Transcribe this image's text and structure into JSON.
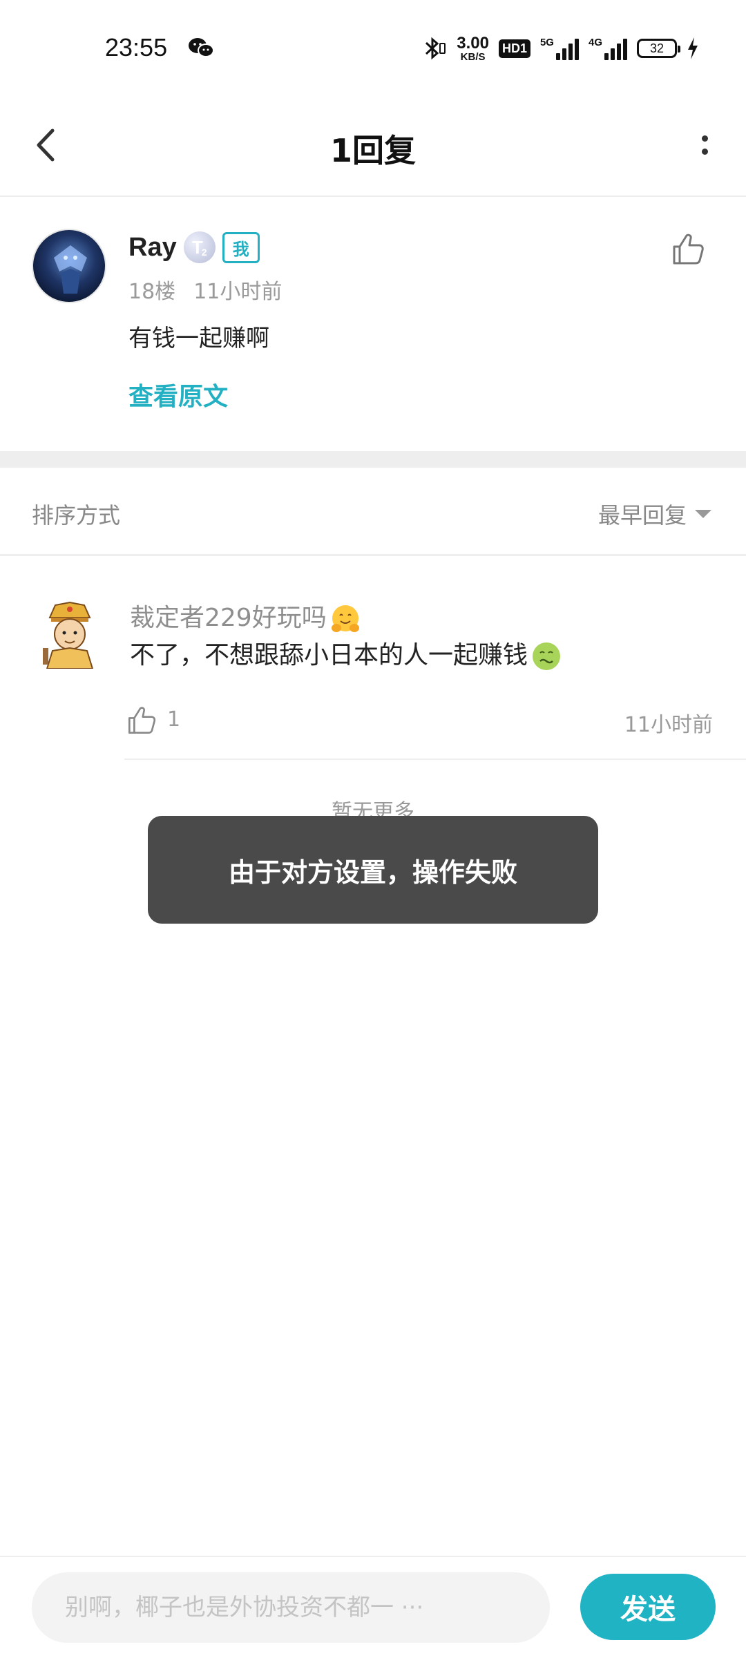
{
  "status_bar": {
    "time": "23:55",
    "net_speed_value": "3.00",
    "net_speed_unit": "KB/S",
    "hd_label": "HD1",
    "net1_label": "5G",
    "net2_label": "4G",
    "battery_level": "32"
  },
  "header": {
    "title": "1回复"
  },
  "post": {
    "author": "Ray",
    "level": "T",
    "level_sub": "2",
    "badge": "我",
    "floor": "18楼",
    "time": "11小时前",
    "content": "有钱一起赚啊",
    "view_original": "查看原文"
  },
  "sort": {
    "label": "排序方式",
    "value": "最早回复"
  },
  "reply": {
    "username": "裁定者229好玩吗",
    "content": "不了，不想跟舔小日本的人一起赚钱",
    "like_count": "1",
    "time": "11小时前"
  },
  "no_more": "暂无更多",
  "toast": "由于对方设置，操作失败",
  "input": {
    "placeholder": "别啊，椰子也是外协投资不都一 ···"
  },
  "send_label": "发送",
  "colors": {
    "accent": "#23b0c3",
    "send_button": "#1fb3c4",
    "toast_bg": "#4a4a4a"
  }
}
